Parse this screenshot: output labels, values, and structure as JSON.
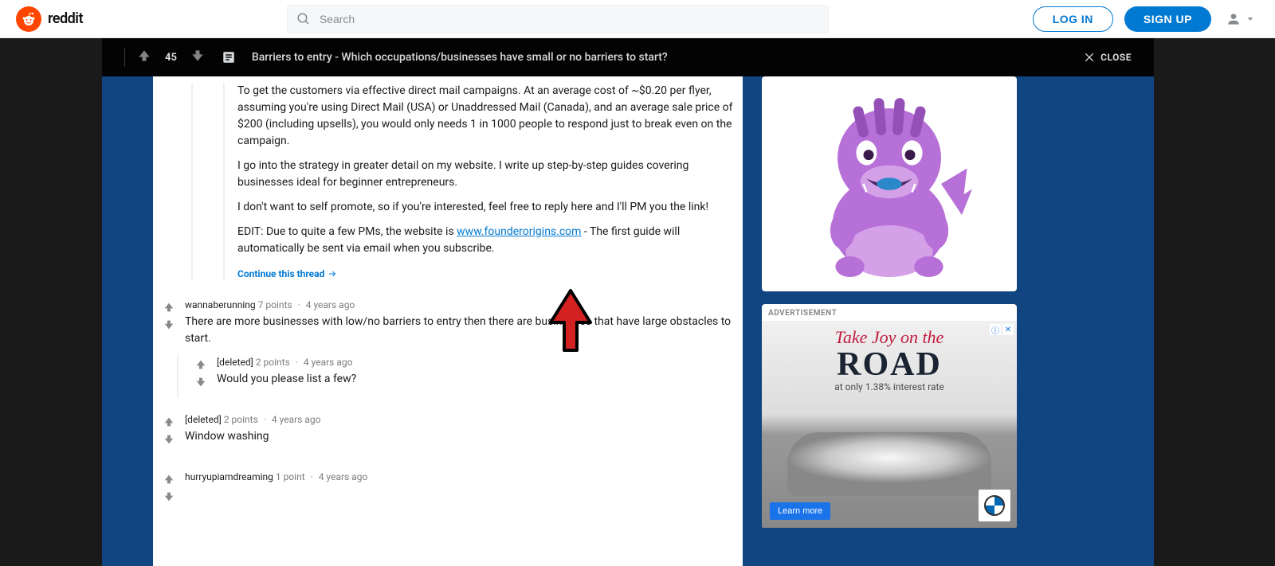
{
  "brand": "reddit",
  "search": {
    "placeholder": "Search"
  },
  "nav": {
    "login": "LOG IN",
    "signup": "SIGN UP"
  },
  "titlebar": {
    "score": "45",
    "title": "Barriers to entry - Which occupations/businesses have small or no barriers to start?",
    "close": "CLOSE"
  },
  "thread": {
    "excerpt": {
      "p1": "To get the customers via effective direct mail campaigns. At an average cost of ~$0.20 per flyer, assuming you're using Direct Mail (USA) or Unaddressed Mail (Canada), and an average sale price of $200 (including upsells), you would only needs 1 in 1000 people to respond just to break even on the campaign.",
      "p2": "I go into the strategy in greater detail on my website. I write up step-by-step guides covering businesses ideal for beginner entrepreneurs.",
      "p3": "I don't want to self promote, so if you're interested, feel free to reply here and I'll PM you the link!",
      "p4_pre": "EDIT: Due to quite a few PMs, the website is ",
      "p4_link": "www.founderorigins.com",
      "p4_post": " - The first guide will automatically be sent via email when you subscribe.",
      "continue": "Continue this thread"
    },
    "c1": {
      "author": "wannaberunning",
      "points": "7 points",
      "age": "4 years ago",
      "text": "There are more businesses with low/no barriers to entry then there are businesses that have large obstacles to start."
    },
    "c1r": {
      "author": "[deleted]",
      "points": "2 points",
      "age": "4 years ago",
      "text": "Would you please list a few?"
    },
    "c2": {
      "author": "[deleted]",
      "points": "2 points",
      "age": "4 years ago",
      "text": "Window washing"
    },
    "c3": {
      "author": "hurryupiamdreaming",
      "points": "1 point",
      "age": "4 years ago"
    }
  },
  "sidebar": {
    "ad_label": "ADVERTISEMENT",
    "ad": {
      "script": "Take Joy on the",
      "big": "ROAD",
      "sub": "at only 1.38% interest rate",
      "cta": "Learn more"
    }
  }
}
